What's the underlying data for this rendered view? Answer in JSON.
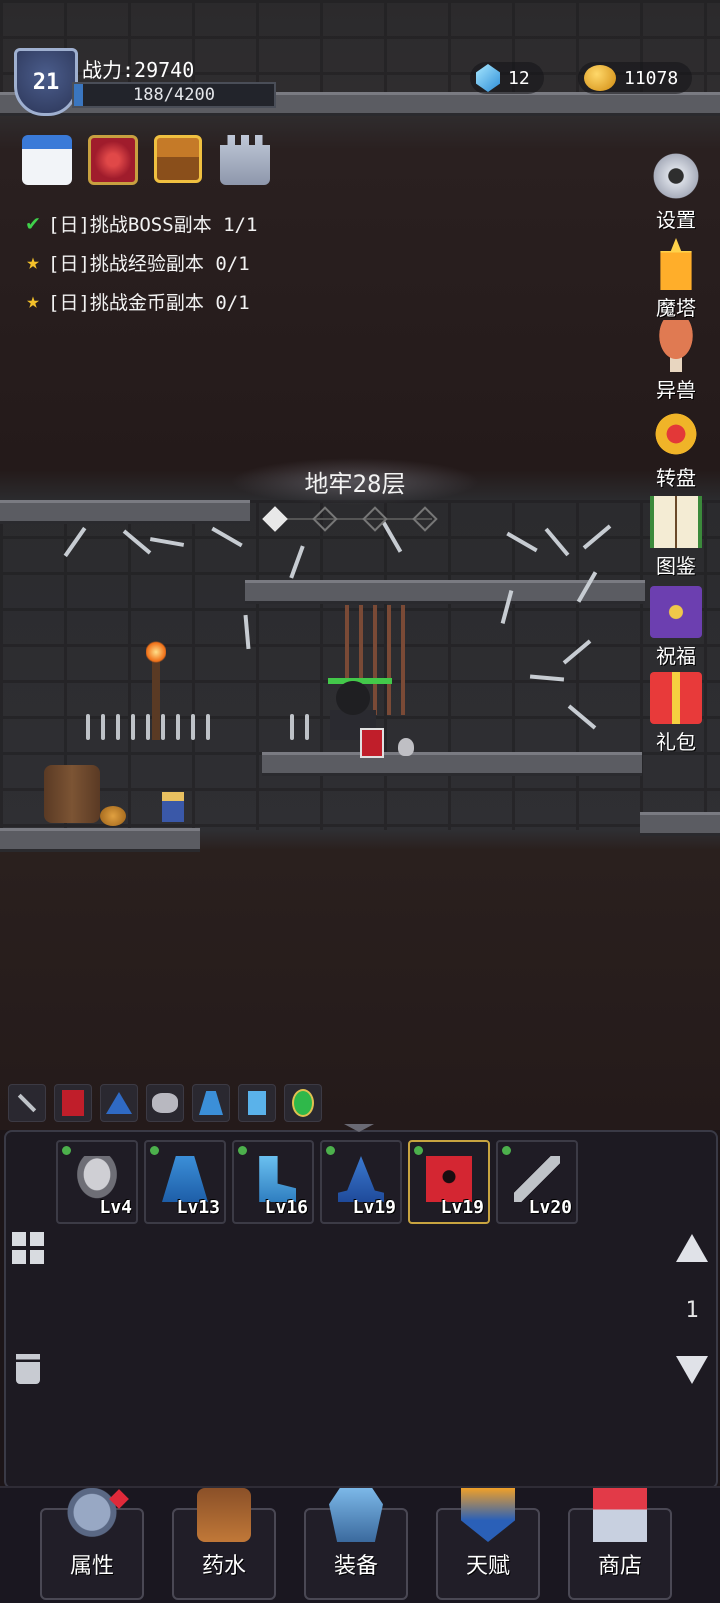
{
  "hud": {
    "level": "21",
    "power": "战力:29740",
    "xp_text": "188/4200",
    "xp_fraction": 0.045,
    "gems": "12",
    "gold": "11078"
  },
  "quick_icons": [
    "calendar-icon",
    "magic-book-icon",
    "treasure-chest-icon",
    "castle-icon"
  ],
  "quests": [
    {
      "status": "done",
      "text": "[日]挑战BOSS副本 1/1"
    },
    {
      "status": "pending",
      "text": "[日]挑战经验副本 0/1"
    },
    {
      "status": "pending",
      "text": "[日]挑战金币副本 0/1"
    }
  ],
  "side_menu": [
    {
      "icon": "gear-icon",
      "label": "设置"
    },
    {
      "icon": "tower-icon",
      "label": "魔塔"
    },
    {
      "icon": "mushroom-icon",
      "label": "异兽"
    },
    {
      "icon": "wheel-icon",
      "label": "转盘"
    },
    {
      "icon": "book-icon",
      "label": "图鉴"
    },
    {
      "icon": "blessing-icon",
      "label": "祝福"
    },
    {
      "icon": "gift-icon",
      "label": "礼包"
    }
  ],
  "dungeon": {
    "floor_title": "地牢28层",
    "stage_dots": 4,
    "active_dot": 0
  },
  "bag": {
    "items": [
      {
        "icon": "armor-icon",
        "level": "Lv4"
      },
      {
        "icon": "robe-icon",
        "level": "Lv13"
      },
      {
        "icon": "boots-icon",
        "level": "Lv16"
      },
      {
        "icon": "hat-icon",
        "level": "Lv19"
      },
      {
        "icon": "skull-tome-icon",
        "level": "Lv19",
        "selected": true
      },
      {
        "icon": "sword-icon",
        "level": "Lv20"
      }
    ],
    "page": "1"
  },
  "bottom_nav": [
    {
      "icon": "helmet-icon",
      "label": "属性"
    },
    {
      "icon": "potion-bag-icon",
      "label": "药水"
    },
    {
      "icon": "chest-armor-icon",
      "label": "装备"
    },
    {
      "icon": "talent-shield-icon",
      "label": "天赋"
    },
    {
      "icon": "shop-icon",
      "label": "商店"
    }
  ],
  "colors": {
    "accent_gold": "#c8a440",
    "hp_green": "#43c84a",
    "check_green": "#3fd04a",
    "star_yellow": "#f3c02a"
  }
}
